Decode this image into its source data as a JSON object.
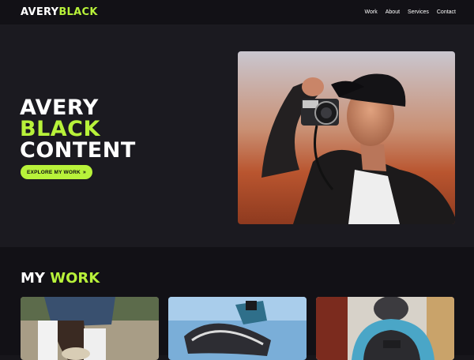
{
  "header": {
    "logo_first": "AVERY",
    "logo_second": "BLACK",
    "nav": [
      "Work",
      "About",
      "Services",
      "Contact"
    ]
  },
  "hero": {
    "line1": "AVERY",
    "line2": "BLACK",
    "line3": "CONTENT",
    "cta_label": "EXPLORE MY WORK",
    "cta_icon": "double-chevron-right-icon",
    "photo_alt": "photographer-with-camera"
  },
  "work": {
    "title_first": "MY",
    "title_second": "WORK",
    "cards": [
      "sneakers-photo",
      "skate-shoe-photo",
      "backpack-photo"
    ]
  },
  "colors": {
    "accent": "#b8f23a",
    "background": "#1b1a20",
    "header_bg": "#121116"
  }
}
